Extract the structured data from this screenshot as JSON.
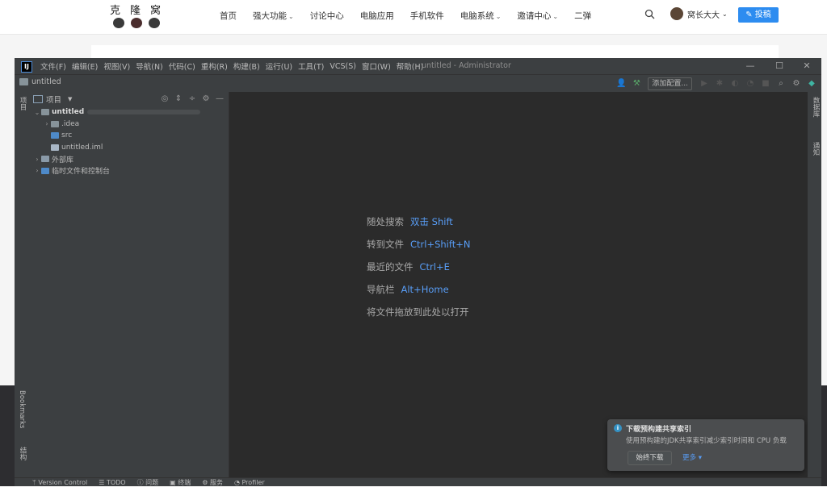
{
  "site": {
    "logo_text": "克隆窝",
    "nav": [
      {
        "label": "首页",
        "has_dropdown": false
      },
      {
        "label": "强大功能",
        "has_dropdown": true
      },
      {
        "label": "讨论中心",
        "has_dropdown": false
      },
      {
        "label": "电脑应用",
        "has_dropdown": false
      },
      {
        "label": "手机软件",
        "has_dropdown": false
      },
      {
        "label": "电脑系统",
        "has_dropdown": true
      },
      {
        "label": "邀请中心",
        "has_dropdown": true
      },
      {
        "label": "二弹",
        "has_dropdown": false
      }
    ],
    "user_name": "窝长大大",
    "submit_label": "投稿",
    "accent": "#2d8cf0"
  },
  "ide": {
    "app_icon": "IJ",
    "menus": [
      "文件(F)",
      "编辑(E)",
      "视图(V)",
      "导航(N)",
      "代码(C)",
      "重构(R)",
      "构建(B)",
      "运行(U)",
      "工具(T)",
      "VCS(S)",
      "窗口(W)",
      "帮助(H)"
    ],
    "window_title": "untitled - Administrator",
    "breadcrumb": "untitled",
    "add_config_label": "添加配置...",
    "left_tool_top": "项目",
    "left_tool_bookmarks": "Bookmarks",
    "left_tool_structure": "结构",
    "right_tool_db": "数据库",
    "right_tool_notify": "通知",
    "project_panel": {
      "title": "项目",
      "tree": [
        {
          "label": "untitled",
          "indent": 0,
          "arrow": "⌄",
          "bold": true,
          "icon": "folder"
        },
        {
          "label": ".idea",
          "indent": 1,
          "arrow": "›",
          "bold": false,
          "icon": "folder"
        },
        {
          "label": "src",
          "indent": 1,
          "arrow": "",
          "bold": false,
          "icon": "folder-src"
        },
        {
          "label": "untitled.iml",
          "indent": 1,
          "arrow": "",
          "bold": false,
          "icon": "file"
        },
        {
          "label": "外部库",
          "indent": 0,
          "arrow": "›",
          "bold": false,
          "icon": "library"
        },
        {
          "label": "临时文件和控制台",
          "indent": 0,
          "arrow": "›",
          "bold": false,
          "icon": "scratch"
        }
      ]
    },
    "hints": [
      {
        "label": "随处搜索",
        "key": "双击 Shift"
      },
      {
        "label": "转到文件",
        "key": "Ctrl+Shift+N"
      },
      {
        "label": "最近的文件",
        "key": "Ctrl+E"
      },
      {
        "label": "导航栏",
        "key": "Alt+Home"
      },
      {
        "label": "将文件拖放到此处以打开",
        "key": ""
      }
    ],
    "bottom_tabs": [
      "Version Control",
      "TODO",
      "问题",
      "终端",
      "服务",
      "Profiler"
    ],
    "notification": {
      "title": "下载预构建共享索引",
      "body": "使用预构建的JDK共享索引减少索引时间和 CPU 负载",
      "button": "始终下载",
      "more": "更多 ▾"
    }
  }
}
